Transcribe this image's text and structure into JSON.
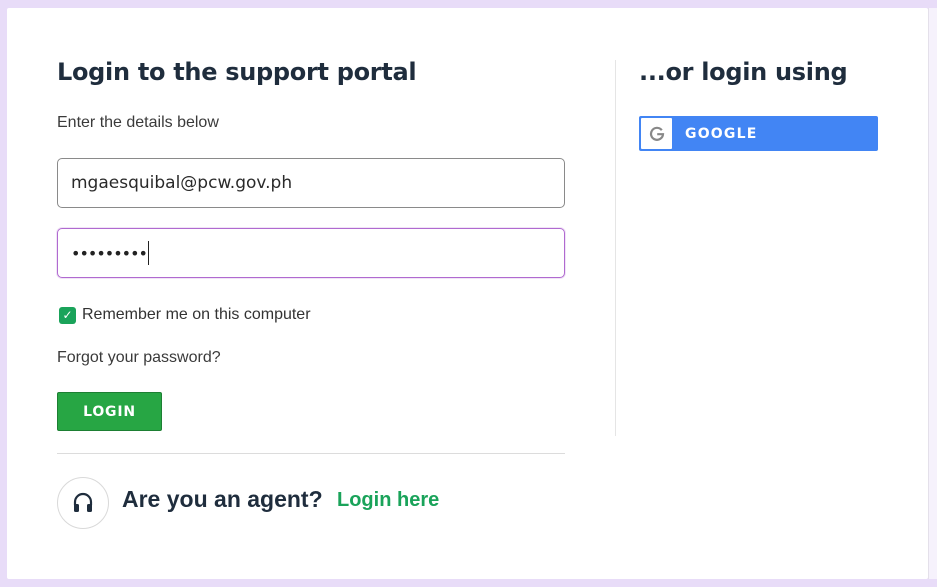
{
  "login_form": {
    "title": "Login to the support portal",
    "subtitle": "Enter the details below",
    "email_value": "mgaesquibal@pcw.gov.ph",
    "password_mask": "•••••••••",
    "remember_label": "Remember me on this computer",
    "remember_checked": true,
    "forgot_link": "Forgot your password?",
    "login_button": "LOGIN"
  },
  "agent": {
    "question": "Are you an agent?",
    "link": "Login here",
    "icon": "headset-icon"
  },
  "alternative": {
    "title": "...or login using",
    "google_button": "GOOGLE",
    "google_icon": "google-g-icon"
  },
  "colors": {
    "background": "#e8dcf8",
    "primary_green": "#27a644",
    "link_green": "#1aa35a",
    "google_blue": "#4285f4",
    "heading": "#1f2d3d",
    "focus_border": "#b06ad0"
  }
}
